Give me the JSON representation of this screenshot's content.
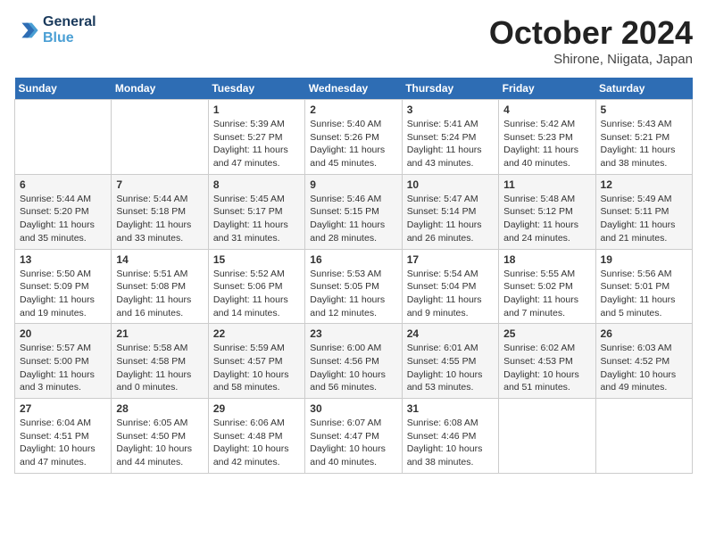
{
  "header": {
    "logo_line1": "General",
    "logo_line2": "Blue",
    "month_title": "October 2024",
    "location": "Shirone, Niigata, Japan"
  },
  "days_of_week": [
    "Sunday",
    "Monday",
    "Tuesday",
    "Wednesday",
    "Thursday",
    "Friday",
    "Saturday"
  ],
  "weeks": [
    [
      {
        "day": "",
        "content": ""
      },
      {
        "day": "",
        "content": ""
      },
      {
        "day": "1",
        "content": "Sunrise: 5:39 AM\nSunset: 5:27 PM\nDaylight: 11 hours and 47 minutes."
      },
      {
        "day": "2",
        "content": "Sunrise: 5:40 AM\nSunset: 5:26 PM\nDaylight: 11 hours and 45 minutes."
      },
      {
        "day": "3",
        "content": "Sunrise: 5:41 AM\nSunset: 5:24 PM\nDaylight: 11 hours and 43 minutes."
      },
      {
        "day": "4",
        "content": "Sunrise: 5:42 AM\nSunset: 5:23 PM\nDaylight: 11 hours and 40 minutes."
      },
      {
        "day": "5",
        "content": "Sunrise: 5:43 AM\nSunset: 5:21 PM\nDaylight: 11 hours and 38 minutes."
      }
    ],
    [
      {
        "day": "6",
        "content": "Sunrise: 5:44 AM\nSunset: 5:20 PM\nDaylight: 11 hours and 35 minutes."
      },
      {
        "day": "7",
        "content": "Sunrise: 5:44 AM\nSunset: 5:18 PM\nDaylight: 11 hours and 33 minutes."
      },
      {
        "day": "8",
        "content": "Sunrise: 5:45 AM\nSunset: 5:17 PM\nDaylight: 11 hours and 31 minutes."
      },
      {
        "day": "9",
        "content": "Sunrise: 5:46 AM\nSunset: 5:15 PM\nDaylight: 11 hours and 28 minutes."
      },
      {
        "day": "10",
        "content": "Sunrise: 5:47 AM\nSunset: 5:14 PM\nDaylight: 11 hours and 26 minutes."
      },
      {
        "day": "11",
        "content": "Sunrise: 5:48 AM\nSunset: 5:12 PM\nDaylight: 11 hours and 24 minutes."
      },
      {
        "day": "12",
        "content": "Sunrise: 5:49 AM\nSunset: 5:11 PM\nDaylight: 11 hours and 21 minutes."
      }
    ],
    [
      {
        "day": "13",
        "content": "Sunrise: 5:50 AM\nSunset: 5:09 PM\nDaylight: 11 hours and 19 minutes."
      },
      {
        "day": "14",
        "content": "Sunrise: 5:51 AM\nSunset: 5:08 PM\nDaylight: 11 hours and 16 minutes."
      },
      {
        "day": "15",
        "content": "Sunrise: 5:52 AM\nSunset: 5:06 PM\nDaylight: 11 hours and 14 minutes."
      },
      {
        "day": "16",
        "content": "Sunrise: 5:53 AM\nSunset: 5:05 PM\nDaylight: 11 hours and 12 minutes."
      },
      {
        "day": "17",
        "content": "Sunrise: 5:54 AM\nSunset: 5:04 PM\nDaylight: 11 hours and 9 minutes."
      },
      {
        "day": "18",
        "content": "Sunrise: 5:55 AM\nSunset: 5:02 PM\nDaylight: 11 hours and 7 minutes."
      },
      {
        "day": "19",
        "content": "Sunrise: 5:56 AM\nSunset: 5:01 PM\nDaylight: 11 hours and 5 minutes."
      }
    ],
    [
      {
        "day": "20",
        "content": "Sunrise: 5:57 AM\nSunset: 5:00 PM\nDaylight: 11 hours and 3 minutes."
      },
      {
        "day": "21",
        "content": "Sunrise: 5:58 AM\nSunset: 4:58 PM\nDaylight: 11 hours and 0 minutes."
      },
      {
        "day": "22",
        "content": "Sunrise: 5:59 AM\nSunset: 4:57 PM\nDaylight: 10 hours and 58 minutes."
      },
      {
        "day": "23",
        "content": "Sunrise: 6:00 AM\nSunset: 4:56 PM\nDaylight: 10 hours and 56 minutes."
      },
      {
        "day": "24",
        "content": "Sunrise: 6:01 AM\nSunset: 4:55 PM\nDaylight: 10 hours and 53 minutes."
      },
      {
        "day": "25",
        "content": "Sunrise: 6:02 AM\nSunset: 4:53 PM\nDaylight: 10 hours and 51 minutes."
      },
      {
        "day": "26",
        "content": "Sunrise: 6:03 AM\nSunset: 4:52 PM\nDaylight: 10 hours and 49 minutes."
      }
    ],
    [
      {
        "day": "27",
        "content": "Sunrise: 6:04 AM\nSunset: 4:51 PM\nDaylight: 10 hours and 47 minutes."
      },
      {
        "day": "28",
        "content": "Sunrise: 6:05 AM\nSunset: 4:50 PM\nDaylight: 10 hours and 44 minutes."
      },
      {
        "day": "29",
        "content": "Sunrise: 6:06 AM\nSunset: 4:48 PM\nDaylight: 10 hours and 42 minutes."
      },
      {
        "day": "30",
        "content": "Sunrise: 6:07 AM\nSunset: 4:47 PM\nDaylight: 10 hours and 40 minutes."
      },
      {
        "day": "31",
        "content": "Sunrise: 6:08 AM\nSunset: 4:46 PM\nDaylight: 10 hours and 38 minutes."
      },
      {
        "day": "",
        "content": ""
      },
      {
        "day": "",
        "content": ""
      }
    ]
  ]
}
